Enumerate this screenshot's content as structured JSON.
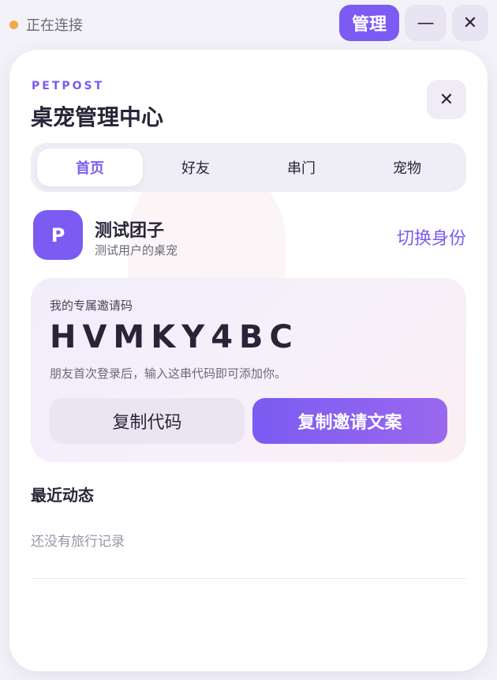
{
  "topbar": {
    "status": "正在连接",
    "status_color": "#f0a94a",
    "manage_label": "管理",
    "minimize_symbol": "—",
    "close_symbol": "✕"
  },
  "header": {
    "brand": "PETPOST",
    "title": "桌宠管理中心",
    "close_symbol": "✕"
  },
  "tabs": [
    {
      "label": "首页",
      "active": true
    },
    {
      "label": "好友",
      "active": false
    },
    {
      "label": "串门",
      "active": false
    },
    {
      "label": "宠物",
      "active": false
    }
  ],
  "profile": {
    "avatar_letter": "P",
    "name": "测试团子",
    "subtitle": "测试用户的桌宠",
    "switch_label": "切换身份"
  },
  "invite": {
    "label": "我的专属邀请码",
    "code": "HVMKY4BC",
    "hint": "朋友首次登录后，输入这串代码即可添加你。",
    "copy_code_label": "复制代码",
    "copy_invite_label": "复制邀请文案"
  },
  "recent": {
    "title": "最近动态",
    "empty_text": "还没有旅行记录"
  },
  "colors": {
    "accent": "#7b5bf2",
    "status_dot": "#f0a94a"
  }
}
